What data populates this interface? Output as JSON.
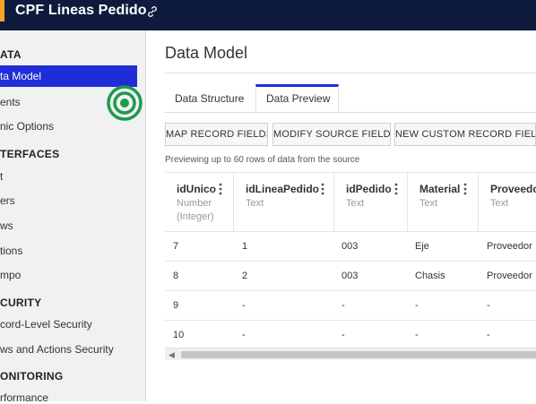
{
  "app": {
    "title": "CPF Lineas Pedido",
    "link_icon": "link-icon"
  },
  "sidebar": {
    "sections": [
      {
        "header": "ATA",
        "items": [
          "ta Model",
          "ents",
          "nic Options"
        ]
      },
      {
        "header": "TERFACES",
        "items": [
          "t",
          "ers",
          "ws",
          "tions",
          "mpo"
        ]
      },
      {
        "header": "CURITY",
        "items": [
          "cord-Level Security",
          "ws and Actions Security"
        ]
      },
      {
        "header": "ONITORING",
        "items": [
          "rformance"
        ]
      }
    ],
    "active_item": "ta Model",
    "active_color": "#1f2dd8"
  },
  "main": {
    "title": "Data Model",
    "tabs": [
      {
        "label": "Data Structure",
        "active": false
      },
      {
        "label": "Data Preview",
        "active": true
      }
    ],
    "buttons": [
      "MAP RECORD FIELDS",
      "MODIFY SOURCE FIELDS",
      "NEW CUSTOM RECORD FIELD"
    ],
    "preview_note": "Previewing up to 60 rows of data from the source",
    "columns": [
      {
        "name": "idUnico",
        "type": "Number (Integer)"
      },
      {
        "name": "idLineaPedido",
        "type": "Text"
      },
      {
        "name": "idPedido",
        "type": "Text"
      },
      {
        "name": "Material",
        "type": "Text"
      },
      {
        "name": "Proveedor",
        "type": "Text"
      }
    ],
    "rows": [
      [
        "7",
        "1",
        "003",
        "Eje",
        "Proveedor"
      ],
      [
        "8",
        "2",
        "003",
        "Chasis",
        "Proveedor"
      ],
      [
        "9",
        "-",
        "-",
        "-",
        "-"
      ],
      [
        "10",
        "-",
        "-",
        "-",
        "-"
      ]
    ]
  },
  "colors": {
    "topbar": "#0f1b3d",
    "accent_orange": "#f5a623",
    "target_green": "#1a9b4b"
  }
}
